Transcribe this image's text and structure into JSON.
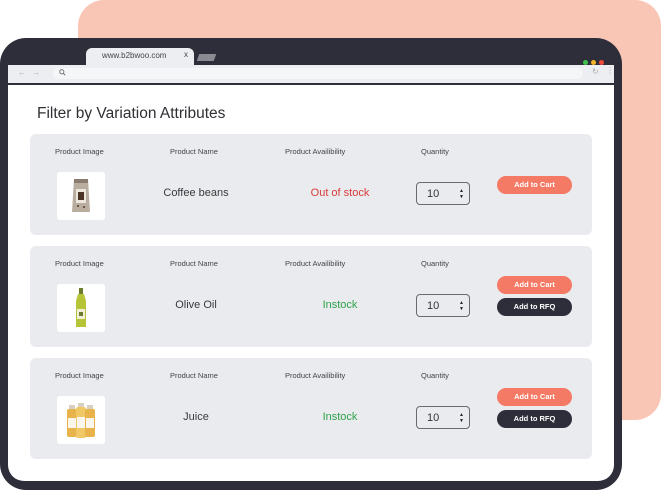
{
  "browser": {
    "tab_title": "www.b2bwoo.com",
    "tab_close": "x",
    "nav_arrows": "← →",
    "reload": "↻",
    "menu": "⋮"
  },
  "heading": "Filter by Variation Attributes",
  "columns": {
    "image": "Product Image",
    "name": "Product Name",
    "availability": "Product Availibility",
    "quantity": "Quantity"
  },
  "products": [
    {
      "name": "Coffee beans",
      "availability": "Out of stock",
      "availability_color": "#d93b3b",
      "quantity": "10",
      "cart_label": "Add to Cart",
      "rfq_label": null,
      "icon": "coffee-bag-icon"
    },
    {
      "name": "Olive Oil",
      "availability": "Instock",
      "availability_color": "#2ea24a",
      "quantity": "10",
      "cart_label": "Add to Cart",
      "rfq_label": "Add to RFQ",
      "icon": "olive-oil-bottle-icon"
    },
    {
      "name": "Juice",
      "availability": "Instock",
      "availability_color": "#2ea24a",
      "quantity": "10",
      "cart_label": "Add to Cart",
      "rfq_label": "Add to RFQ",
      "icon": "juice-bottles-icon"
    }
  ],
  "colors": {
    "accent": "#f47a66",
    "dark": "#2e2e3b",
    "card_bg": "#e9ebee",
    "blob": "#f9c6b6"
  }
}
